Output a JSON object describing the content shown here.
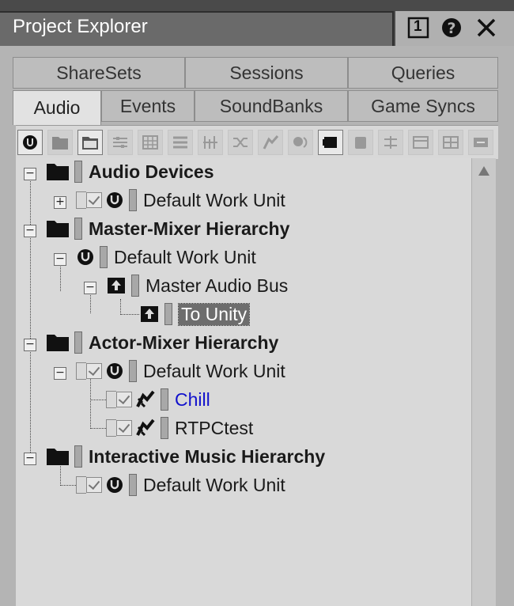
{
  "window": {
    "title": "Project Explorer",
    "badge": "1"
  },
  "tabs_row1": [
    {
      "label": "ShareSets"
    },
    {
      "label": "Sessions"
    },
    {
      "label": "Queries"
    }
  ],
  "tabs_row2": [
    {
      "label": "Audio",
      "active": true
    },
    {
      "label": "Events"
    },
    {
      "label": "SoundBanks"
    },
    {
      "label": "Game Syncs"
    }
  ],
  "toolbar_icons": [
    "work-unit-icon",
    "folder-icon",
    "virtual-folder-icon",
    "actor-mixer-icon",
    "random-container-icon",
    "sequence-container-icon",
    "switch-container-icon",
    "blend-container-icon",
    "sound-sfx-icon",
    "sound-voice-icon",
    "audio-bus-icon",
    "aux-bus-icon",
    "music-switch-icon",
    "music-playlist-icon",
    "music-segment-icon",
    "music-track-icon"
  ],
  "tree": {
    "audio_devices": "Audio Devices",
    "audio_devices_wu": "Default Work Unit",
    "master_mixer": "Master-Mixer Hierarchy",
    "master_mixer_wu": "Default Work Unit",
    "master_audio_bus": "Master Audio Bus",
    "to_unity": "To Unity",
    "actor_mixer": "Actor-Mixer Hierarchy",
    "actor_mixer_wu": "Default Work Unit",
    "chill": "Chill",
    "rtpctest": "RTPCtest",
    "interactive_music": "Interactive Music Hierarchy",
    "interactive_music_wu": "Default Work Unit"
  }
}
